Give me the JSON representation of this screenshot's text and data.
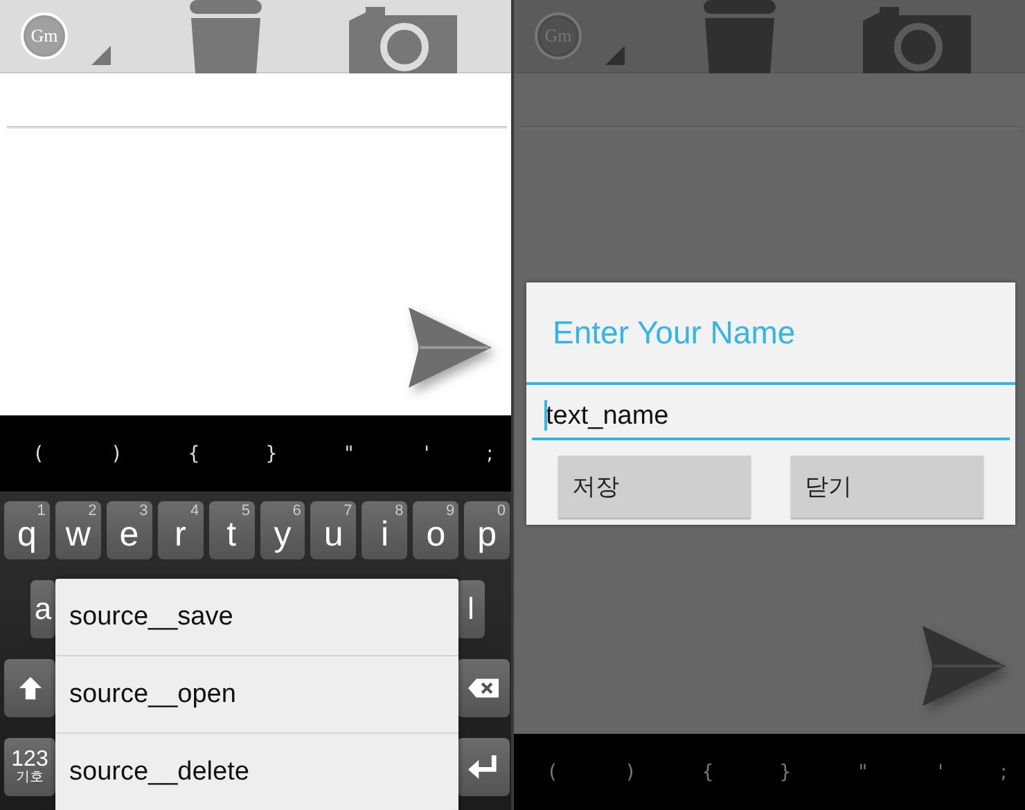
{
  "screens": [
    {
      "dimmed": false,
      "logo_text": "Gm",
      "symbol_bar": [
        "(",
        ")",
        "{",
        "}",
        "\"",
        "'",
        ";"
      ],
      "keyboard": {
        "top_row": [
          {
            "key": "q",
            "hint": "1"
          },
          {
            "key": "w",
            "hint": "2"
          },
          {
            "key": "e",
            "hint": "3"
          },
          {
            "key": "r",
            "hint": "4"
          },
          {
            "key": "t",
            "hint": "5"
          },
          {
            "key": "y",
            "hint": "6"
          },
          {
            "key": "u",
            "hint": "7"
          },
          {
            "key": "i",
            "hint": "8"
          },
          {
            "key": "o",
            "hint": "9"
          },
          {
            "key": "p",
            "hint": "0"
          }
        ],
        "middle_row": [
          "a",
          "l"
        ],
        "mode_key": {
          "label": "123",
          "sublabel": "기호"
        }
      },
      "popup_menu": [
        {
          "label": "source__save"
        },
        {
          "label": "source__open"
        },
        {
          "label": "source__delete"
        }
      ]
    },
    {
      "dimmed": true,
      "logo_text": "Gm",
      "symbol_bar": [
        "(",
        ")",
        "{",
        "}",
        "\"",
        "'",
        ";"
      ],
      "dialog": {
        "title": "Enter Your Name",
        "value": "text_name",
        "buttons": [
          "저장",
          "닫기"
        ]
      }
    }
  ]
}
